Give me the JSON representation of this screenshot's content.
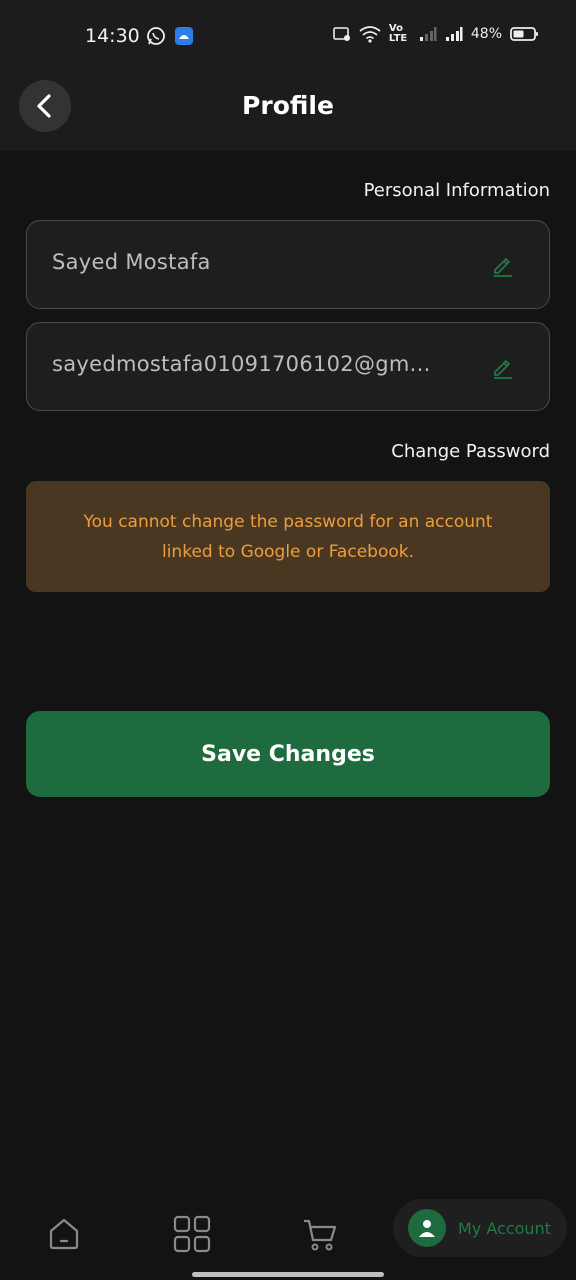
{
  "status_bar": {
    "time": "14:30",
    "network_label": "Vo LTE",
    "battery": "48%"
  },
  "header": {
    "title": "Profile",
    "back_icon": "chevron-left-icon"
  },
  "personal_info": {
    "label": "Personal Information",
    "name_value": "Sayed Mostafa",
    "email_value": "sayedmostafa01091706102@gm...",
    "edit_icon": "pencil-icon"
  },
  "password": {
    "label": "Change Password",
    "notice": "You cannot change the password for an account linked to Google or Facebook."
  },
  "actions": {
    "save_label": "Save Changes"
  },
  "bottom_nav": {
    "account_label": "My Account"
  },
  "colors": {
    "accent_green": "#1d6b3f",
    "warning_bg": "#4a3721",
    "warning_text": "#ea9e40",
    "background": "#131313"
  }
}
